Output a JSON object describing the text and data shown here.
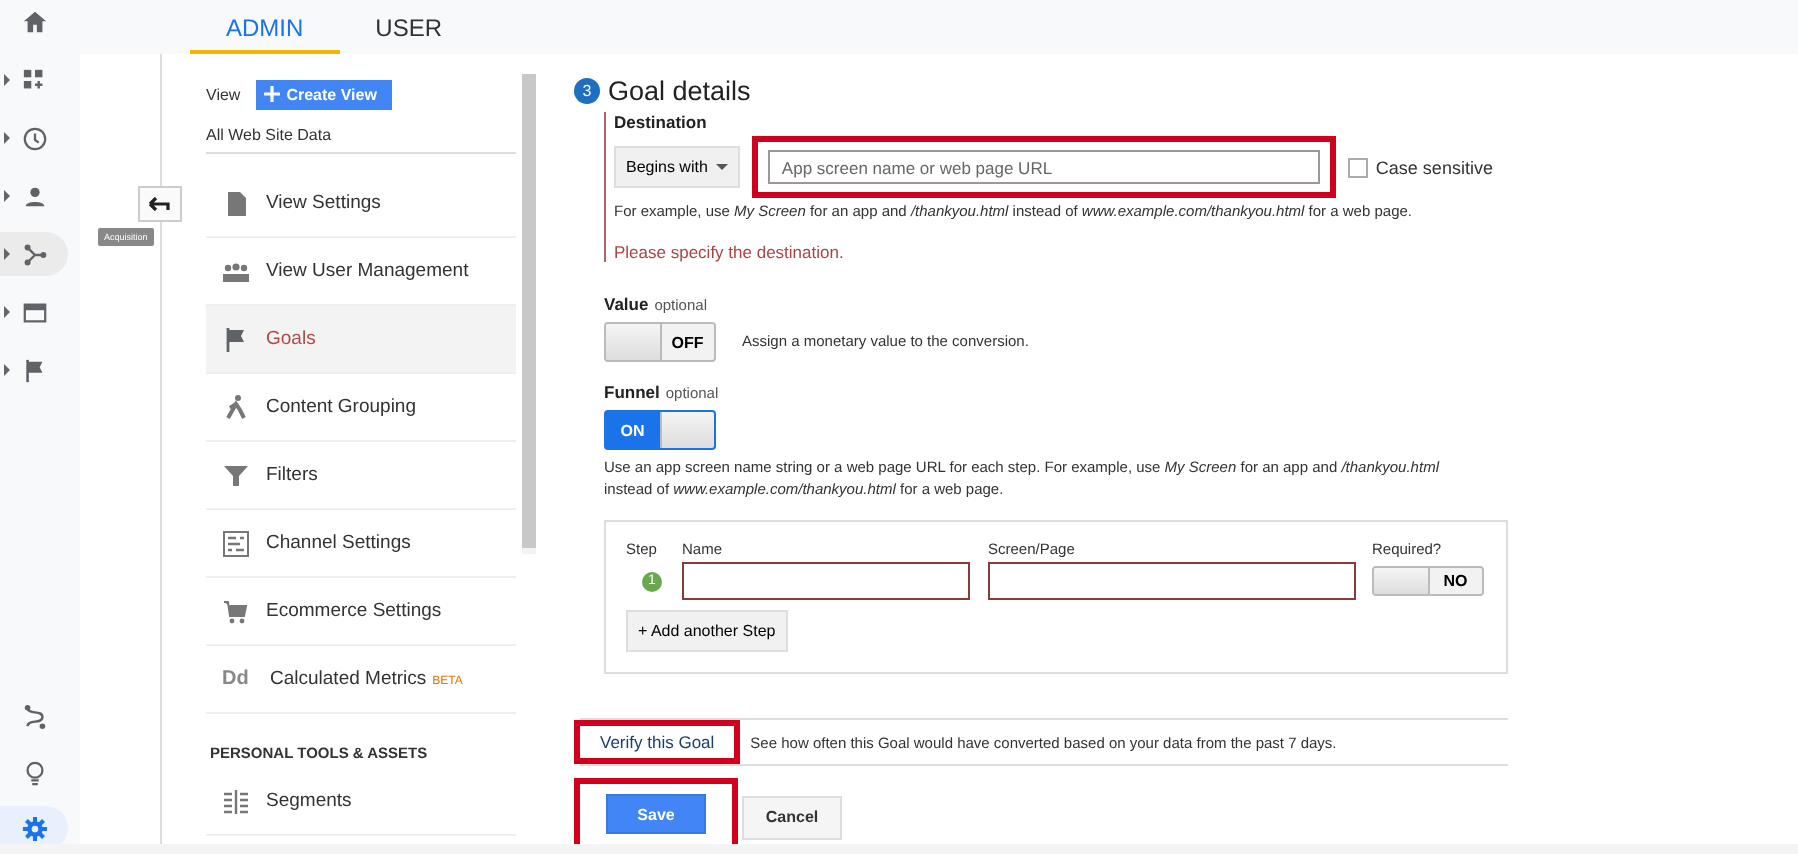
{
  "rail": {
    "items": [
      {
        "kind": "home",
        "expandable": false,
        "selected": false
      },
      {
        "kind": "dashboard",
        "expandable": true,
        "selected": false
      },
      {
        "kind": "clock",
        "expandable": true,
        "selected": false
      },
      {
        "kind": "person",
        "expandable": true,
        "selected": false
      },
      {
        "kind": "acquisition",
        "expandable": true,
        "selected": true
      },
      {
        "kind": "behavior",
        "expandable": true,
        "selected": false
      },
      {
        "kind": "flag",
        "expandable": true,
        "selected": false
      }
    ],
    "tooltip": "Acquisition",
    "bottom_items": [
      {
        "kind": "route",
        "selected": false
      },
      {
        "kind": "bulb",
        "selected": false
      },
      {
        "kind": "gear",
        "selected": true
      }
    ]
  },
  "tabs": [
    {
      "label": "ADMIN",
      "selected": true
    },
    {
      "label": "USER",
      "selected": false
    }
  ],
  "view_column": {
    "label": "View",
    "create_button": "Create View",
    "view_name": "All Web Site Data",
    "items": [
      {
        "kind": "doc",
        "label": "View Settings",
        "selected": false
      },
      {
        "kind": "people",
        "label": "View User Management",
        "selected": false
      },
      {
        "kind": "flag",
        "label": "Goals",
        "selected": true
      },
      {
        "kind": "grouping",
        "label": "Content Grouping",
        "selected": false
      },
      {
        "kind": "filter",
        "label": "Filters",
        "selected": false
      },
      {
        "kind": "channel",
        "label": "Channel Settings",
        "selected": false
      },
      {
        "kind": "cart",
        "label": "Ecommerce Settings",
        "selected": false
      },
      {
        "kind": "letters",
        "icon_text": "Dd",
        "label": "Calculated Metrics",
        "badge": "BETA",
        "selected": false
      }
    ],
    "section_heading": "PERSONAL TOOLS & ASSETS",
    "section_items": [
      {
        "kind": "segments",
        "label": "Segments",
        "selected": false
      }
    ]
  },
  "goal_details": {
    "step": "3",
    "title": "Goal details",
    "destination": {
      "label": "Destination",
      "match": "Begins with",
      "placeholder": "App screen name or web page URL",
      "highlighted": true,
      "case_sensitive": {
        "label": "Case sensitive",
        "checked": false
      },
      "example": "For example, use *My Screen* for an app and */thankyou.html* instead of *www.example.com/thankyou.html* for a web page.",
      "error": "Please specify the destination."
    },
    "value": {
      "label": "Value",
      "hint": "optional",
      "on": false,
      "toggle_text": "OFF",
      "description": "Assign a monetary value to the conversion."
    },
    "funnel": {
      "label": "Funnel",
      "hint": "optional",
      "on": true,
      "toggle_text": "ON",
      "description": "Use an app screen name string or a web page URL for each step. For example, use *My Screen* for an app and */thankyou.html* instead of *www.example.com/thankyou.html* for a web page.",
      "columns": [
        "Step",
        "Name",
        "Screen/Page",
        "Required?"
      ],
      "steps": [
        {
          "number": "1",
          "required": {
            "on": false,
            "toggle_text": "NO"
          }
        }
      ],
      "add_button": "+ Add another Step"
    },
    "verify": {
      "link": "Verify this Goal",
      "highlighted": true,
      "description": "See how often this Goal would have converted based on your data from the past 7 days."
    },
    "buttons": [
      {
        "kind": "primary",
        "label": "Save",
        "highlighted": true
      },
      {
        "kind": "secondary",
        "label": "Cancel",
        "highlighted": false
      }
    ]
  }
}
